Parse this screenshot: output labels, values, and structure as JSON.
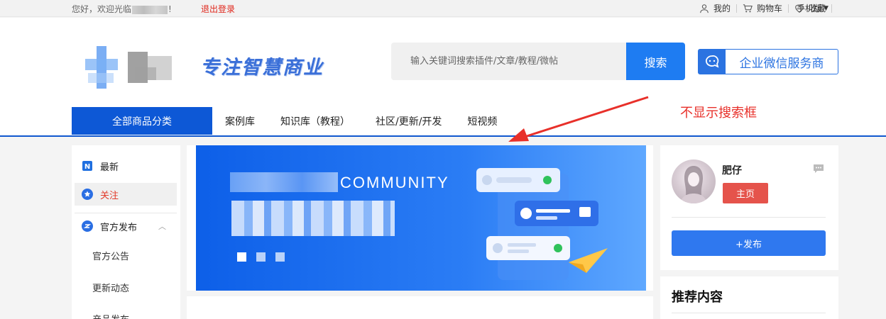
{
  "topbar": {
    "greeting_prefix": "您好，欢迎光临",
    "greeting_suffix": "!",
    "logout": "退出登录",
    "mine": "我的",
    "cart": "购物车",
    "favorites": "收藏",
    "mobile": "手机版"
  },
  "header": {
    "slogan": "专注智慧商业",
    "search_placeholder": "输入关键词搜索插件/文章/教程/微帖",
    "search_button": "搜索",
    "wecom_label": "企业微信服务商"
  },
  "nav": {
    "all_categories": "全部商品分类",
    "links": [
      "案例库",
      "知识库（教程）",
      "社区/更新/开发",
      "短视频"
    ]
  },
  "annotation": {
    "text": "不显示搜索框",
    "color": "#e8302a"
  },
  "sidebar": {
    "items": [
      {
        "label": "最新",
        "icon": "n-badge-icon"
      },
      {
        "label": "关注",
        "icon": "star-circle-icon"
      },
      {
        "label": "官方发布",
        "icon": "official-icon"
      }
    ],
    "sub_items": [
      "官方公告",
      "更新动态",
      "产品发布"
    ]
  },
  "banner": {
    "heading": "COMMUNITY",
    "slides": 3,
    "active_slide": 1
  },
  "profile": {
    "username": "肥仔",
    "home_button": "主页",
    "publish_button": "+发布"
  },
  "recommend": {
    "title": "推荐内容"
  },
  "colors": {
    "brand_blue": "#1e7cf2",
    "nav_blue": "#0d58d6",
    "danger_red": "#e5534b"
  }
}
